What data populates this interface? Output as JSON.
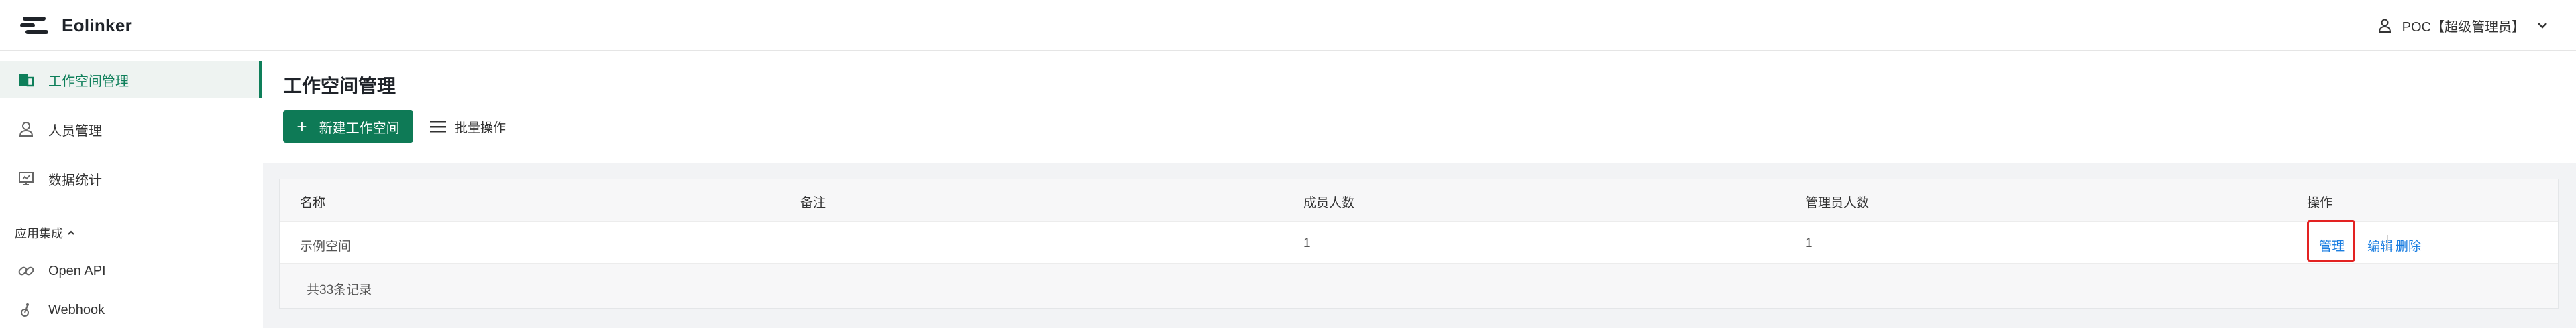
{
  "app": {
    "logo_text": "Eolinker"
  },
  "user": {
    "label": "POC【超级管理员】"
  },
  "sidebar": {
    "items": [
      {
        "label": "工作空间管理",
        "icon": "workspace-icon",
        "active": true
      },
      {
        "label": "人员管理",
        "icon": "person-icon",
        "active": false
      },
      {
        "label": "数据统计",
        "icon": "monitor-icon",
        "active": false
      }
    ],
    "group_label": "应用集成",
    "group_items": [
      {
        "label": "Open API",
        "icon": "link-icon"
      },
      {
        "label": "Webhook",
        "icon": "webhook-icon"
      }
    ]
  },
  "main": {
    "title": "工作空间管理",
    "new_button": "新建工作空间",
    "batch_button": "批量操作"
  },
  "table": {
    "columns": [
      "名称",
      "备注",
      "成员人数",
      "管理员人数",
      "操作"
    ],
    "rows": [
      {
        "name": "示例空间",
        "note": "",
        "members": "1",
        "admins": "1"
      }
    ],
    "actions": {
      "manage": "管理",
      "edit": "编辑",
      "delete": "删除"
    },
    "total": "共33条记录"
  },
  "colors": {
    "brand": "#0e7a56",
    "link": "#1a7de0",
    "highlight": "#e32222"
  }
}
